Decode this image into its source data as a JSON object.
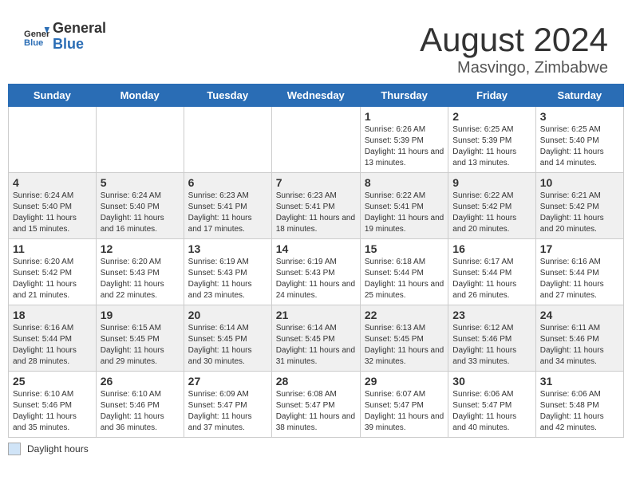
{
  "header": {
    "logo_general": "General",
    "logo_blue": "Blue",
    "month_year": "August 2024",
    "location": "Masvingo, Zimbabwe"
  },
  "days_of_week": [
    "Sunday",
    "Monday",
    "Tuesday",
    "Wednesday",
    "Thursday",
    "Friday",
    "Saturday"
  ],
  "weeks": [
    [
      {
        "day": "",
        "empty": true
      },
      {
        "day": "",
        "empty": true
      },
      {
        "day": "",
        "empty": true
      },
      {
        "day": "",
        "empty": true
      },
      {
        "day": "1",
        "sunrise": "6:26 AM",
        "sunset": "5:39 PM",
        "daylight": "11 hours and 13 minutes."
      },
      {
        "day": "2",
        "sunrise": "6:25 AM",
        "sunset": "5:39 PM",
        "daylight": "11 hours and 13 minutes."
      },
      {
        "day": "3",
        "sunrise": "6:25 AM",
        "sunset": "5:40 PM",
        "daylight": "11 hours and 14 minutes."
      }
    ],
    [
      {
        "day": "4",
        "sunrise": "6:24 AM",
        "sunset": "5:40 PM",
        "daylight": "11 hours and 15 minutes."
      },
      {
        "day": "5",
        "sunrise": "6:24 AM",
        "sunset": "5:40 PM",
        "daylight": "11 hours and 16 minutes."
      },
      {
        "day": "6",
        "sunrise": "6:23 AM",
        "sunset": "5:41 PM",
        "daylight": "11 hours and 17 minutes."
      },
      {
        "day": "7",
        "sunrise": "6:23 AM",
        "sunset": "5:41 PM",
        "daylight": "11 hours and 18 minutes."
      },
      {
        "day": "8",
        "sunrise": "6:22 AM",
        "sunset": "5:41 PM",
        "daylight": "11 hours and 19 minutes."
      },
      {
        "day": "9",
        "sunrise": "6:22 AM",
        "sunset": "5:42 PM",
        "daylight": "11 hours and 20 minutes."
      },
      {
        "day": "10",
        "sunrise": "6:21 AM",
        "sunset": "5:42 PM",
        "daylight": "11 hours and 20 minutes."
      }
    ],
    [
      {
        "day": "11",
        "sunrise": "6:20 AM",
        "sunset": "5:42 PM",
        "daylight": "11 hours and 21 minutes."
      },
      {
        "day": "12",
        "sunrise": "6:20 AM",
        "sunset": "5:43 PM",
        "daylight": "11 hours and 22 minutes."
      },
      {
        "day": "13",
        "sunrise": "6:19 AM",
        "sunset": "5:43 PM",
        "daylight": "11 hours and 23 minutes."
      },
      {
        "day": "14",
        "sunrise": "6:19 AM",
        "sunset": "5:43 PM",
        "daylight": "11 hours and 24 minutes."
      },
      {
        "day": "15",
        "sunrise": "6:18 AM",
        "sunset": "5:44 PM",
        "daylight": "11 hours and 25 minutes."
      },
      {
        "day": "16",
        "sunrise": "6:17 AM",
        "sunset": "5:44 PM",
        "daylight": "11 hours and 26 minutes."
      },
      {
        "day": "17",
        "sunrise": "6:16 AM",
        "sunset": "5:44 PM",
        "daylight": "11 hours and 27 minutes."
      }
    ],
    [
      {
        "day": "18",
        "sunrise": "6:16 AM",
        "sunset": "5:44 PM",
        "daylight": "11 hours and 28 minutes."
      },
      {
        "day": "19",
        "sunrise": "6:15 AM",
        "sunset": "5:45 PM",
        "daylight": "11 hours and 29 minutes."
      },
      {
        "day": "20",
        "sunrise": "6:14 AM",
        "sunset": "5:45 PM",
        "daylight": "11 hours and 30 minutes."
      },
      {
        "day": "21",
        "sunrise": "6:14 AM",
        "sunset": "5:45 PM",
        "daylight": "11 hours and 31 minutes."
      },
      {
        "day": "22",
        "sunrise": "6:13 AM",
        "sunset": "5:45 PM",
        "daylight": "11 hours and 32 minutes."
      },
      {
        "day": "23",
        "sunrise": "6:12 AM",
        "sunset": "5:46 PM",
        "daylight": "11 hours and 33 minutes."
      },
      {
        "day": "24",
        "sunrise": "6:11 AM",
        "sunset": "5:46 PM",
        "daylight": "11 hours and 34 minutes."
      }
    ],
    [
      {
        "day": "25",
        "sunrise": "6:10 AM",
        "sunset": "5:46 PM",
        "daylight": "11 hours and 35 minutes."
      },
      {
        "day": "26",
        "sunrise": "6:10 AM",
        "sunset": "5:46 PM",
        "daylight": "11 hours and 36 minutes."
      },
      {
        "day": "27",
        "sunrise": "6:09 AM",
        "sunset": "5:47 PM",
        "daylight": "11 hours and 37 minutes."
      },
      {
        "day": "28",
        "sunrise": "6:08 AM",
        "sunset": "5:47 PM",
        "daylight": "11 hours and 38 minutes."
      },
      {
        "day": "29",
        "sunrise": "6:07 AM",
        "sunset": "5:47 PM",
        "daylight": "11 hours and 39 minutes."
      },
      {
        "day": "30",
        "sunrise": "6:06 AM",
        "sunset": "5:47 PM",
        "daylight": "11 hours and 40 minutes."
      },
      {
        "day": "31",
        "sunrise": "6:06 AM",
        "sunset": "5:48 PM",
        "daylight": "11 hours and 42 minutes."
      }
    ]
  ],
  "legend": {
    "daylight_label": "Daylight hours"
  }
}
